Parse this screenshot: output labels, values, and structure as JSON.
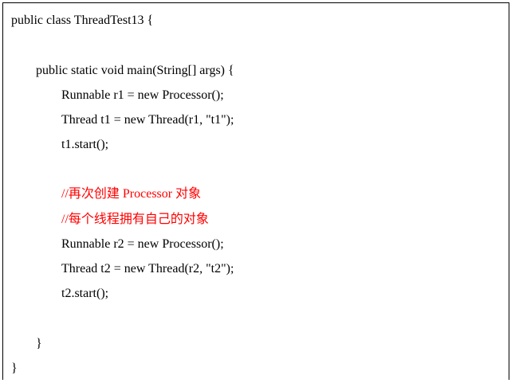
{
  "code": {
    "class_decl": "public class ThreadTest13 {",
    "main_decl": "public static void main(String[] args) {",
    "r1_line": "Runnable r1 = new Processor();",
    "t1_line": "Thread t1 = new Thread(r1, \"t1\");",
    "t1_start": "t1.start();",
    "comment_1": "//再次创建 Processor 对象",
    "comment_2": "//每个线程拥有自己的对象",
    "r2_line": "Runnable r2 = new Processor();",
    "t2_line": "Thread t2 = new Thread(r2, \"t2\");",
    "t2_start": "t2.start();",
    "main_close": "}",
    "class_close": "}"
  },
  "colors": {
    "text": "#000000",
    "comment": "#ff0000",
    "border": "#000000",
    "background": "#ffffff"
  }
}
